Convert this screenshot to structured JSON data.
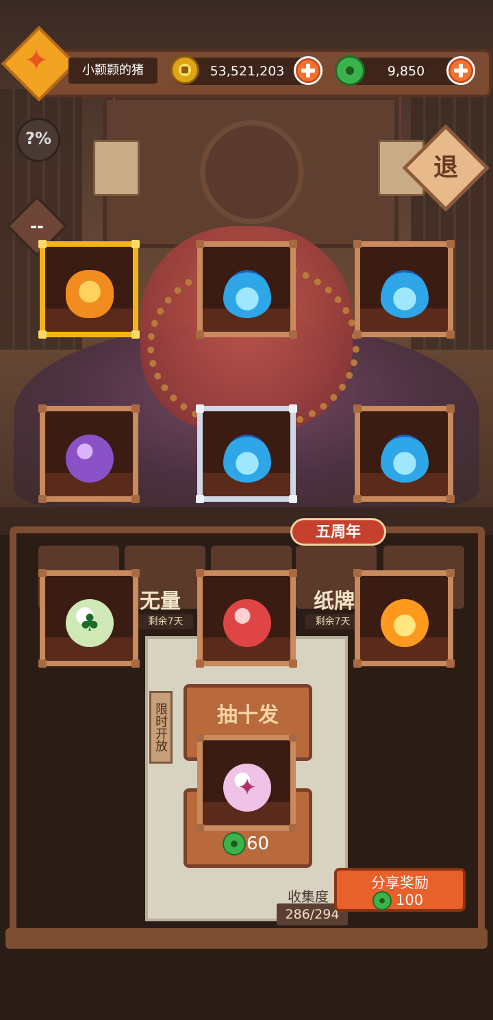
{
  "header": {
    "player_name": "小颢颢的猪",
    "coins": "53,521,203",
    "gems": "9,850"
  },
  "side": {
    "help_text": "?%",
    "exit_text": "退",
    "dash_text": "--"
  },
  "tabs": [
    {
      "label": "无量",
      "time": "剩余7天"
    },
    {
      "label": "纸牌",
      "time": "剩余7天"
    }
  ],
  "anniversary_badge": "五周年",
  "limited_tag": "限时开放",
  "draw": {
    "ten_label": "抽十发",
    "single_price": "60"
  },
  "collection": {
    "label": "收集度",
    "value": "286/294"
  },
  "share": {
    "label": "分享奖励",
    "amount": "100"
  },
  "items": [
    {
      "name": "caterpillar",
      "frame": "gold",
      "icon": "caterpillar-icon"
    },
    {
      "name": "blue-flame",
      "frame": "wood",
      "icon": "blue-flame-icon"
    },
    {
      "name": "blue-flame",
      "frame": "wood",
      "icon": "blue-flame-icon"
    },
    {
      "name": "purple-mask",
      "frame": "wood",
      "icon": "purple-mask-orb-icon"
    },
    {
      "name": "blue-flame",
      "frame": "silver",
      "icon": "blue-flame-icon"
    },
    {
      "name": "blue-flame",
      "frame": "wood",
      "icon": "blue-flame-icon"
    },
    {
      "name": "clover-card",
      "frame": "wood",
      "icon": "clover-card-orb-icon"
    },
    {
      "name": "wing-emblem",
      "frame": "wood",
      "icon": "wing-emblem-orb-icon"
    },
    {
      "name": "fire",
      "frame": "wood",
      "icon": "fire-orb-icon"
    },
    {
      "name": "sparkle-card",
      "frame": "wood",
      "icon": "sparkle-card-orb-icon"
    }
  ],
  "colors": {
    "gold_frame": "#f5b31a",
    "silver_frame": "#cfd8e6",
    "wood_frame": "#c98a5d",
    "accent_orange": "#e8602a",
    "gem_green": "#3bb34a"
  }
}
